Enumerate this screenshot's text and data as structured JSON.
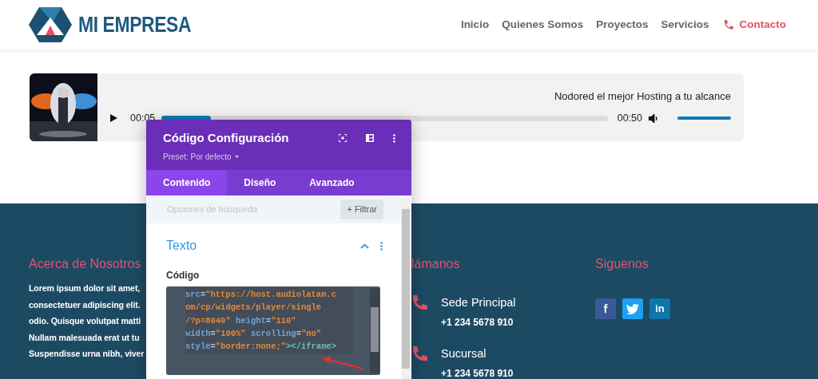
{
  "header": {
    "logo_text": "MI EMPRESA",
    "nav": [
      {
        "label": "Inicio",
        "selected": false
      },
      {
        "label": "Quienes Somos",
        "selected": false
      },
      {
        "label": "Proyectos",
        "selected": false
      },
      {
        "label": "Servicios",
        "selected": false
      },
      {
        "label": "Contacto",
        "selected": true
      }
    ]
  },
  "player": {
    "title": "Nodored el mejor Hosting a tu alcance",
    "current_time": "00:05",
    "duration": "00:50",
    "progress": {
      "level": 0.11
    },
    "volume": {
      "level": 1
    }
  },
  "footer": {
    "about": {
      "heading": "Acerca de Nosotros",
      "lines": [
        "Lorem ipsum dolor sit amet,",
        "consectetuer adipiscing elit.",
        "odio. Quisque volutpat matti",
        "Nullam malesuada erat ut tu",
        "Suspendisse urna nibh, viver"
      ]
    },
    "contact": {
      "heading": "lámanos",
      "items": [
        {
          "name": "Sede Principal",
          "phone": "+1 234 5678 910"
        },
        {
          "name": "Sucursal",
          "phone": "+1 234 5678 910"
        }
      ]
    },
    "social": {
      "heading": "Siguenos",
      "links": [
        {
          "kind": "facebook",
          "label": "f"
        },
        {
          "kind": "twitter"
        },
        {
          "kind": "linkedin",
          "label": "in"
        }
      ]
    }
  },
  "settings_panel": {
    "title": "Código Configuración",
    "preset": "Preset: Por defecto",
    "tabs": [
      {
        "label": "Contenido",
        "selected": true
      },
      {
        "label": "Diseño",
        "selected": false
      },
      {
        "label": "Avanzado",
        "selected": false
      }
    ],
    "search": {
      "placeholder": "Opciones de búsqueda"
    },
    "filter_button": "+ Filtrar",
    "section": {
      "title": "Texto",
      "expanded": true
    },
    "field_label": "Código",
    "code_lines": [
      [
        {
          "kind": "attr",
          "text": "src"
        },
        {
          "kind": "punct",
          "text": "="
        },
        {
          "kind": "string",
          "text": "\"https://host.audiolatam.c"
        }
      ],
      [
        {
          "kind": "string",
          "text": "om/cp/widgets/player/single"
        }
      ],
      [
        {
          "kind": "string",
          "text": "/?p=8040\""
        },
        {
          "kind": "attr",
          "text": " height"
        },
        {
          "kind": "punct",
          "text": "="
        },
        {
          "kind": "string",
          "text": "\"110\""
        }
      ],
      [
        {
          "kind": "attr",
          "text": "width"
        },
        {
          "kind": "punct",
          "text": "="
        },
        {
          "kind": "string",
          "text": "\"100%\""
        },
        {
          "kind": "attr",
          "text": " scrolling"
        },
        {
          "kind": "punct",
          "text": "="
        },
        {
          "kind": "string",
          "text": "\"no\""
        }
      ],
      [
        {
          "kind": "attr",
          "text": "style"
        },
        {
          "kind": "punct",
          "text": "="
        },
        {
          "kind": "string",
          "text": "\"border:none;\""
        },
        {
          "kind": "tag",
          "text": "></iframe>"
        }
      ]
    ]
  }
}
